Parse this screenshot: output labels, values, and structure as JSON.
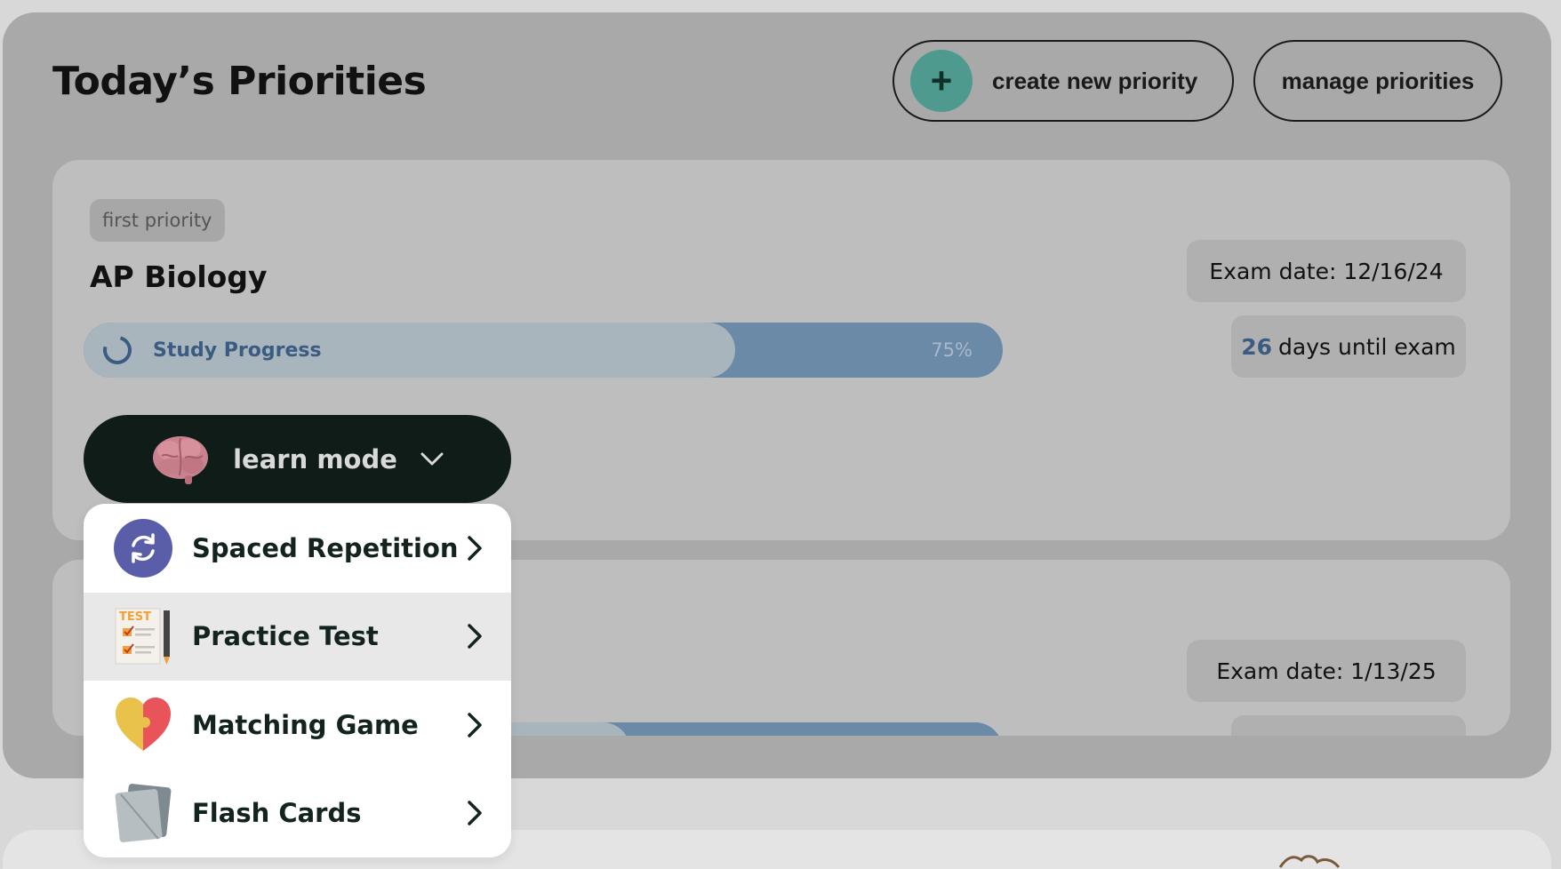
{
  "header": {
    "title": "Today’s Priorities",
    "create_label": "create new priority",
    "manage_label": "manage priorities"
  },
  "priorities": [
    {
      "tag": "first priority",
      "course": "AP Biology",
      "progress_label": "Study Progress",
      "progress_percent": 75,
      "progress_text": "75%",
      "exam_date": "Exam date: 12/16/24",
      "days_until": "26",
      "days_label": "days until exam"
    },
    {
      "exam_date": "Exam date: 1/13/25"
    }
  ],
  "learn_mode": {
    "label": "learn mode",
    "items": [
      {
        "label": "Spaced Repetition",
        "icon": "refresh-icon"
      },
      {
        "label": "Practice Test",
        "icon": "test-sheet-icon"
      },
      {
        "label": "Matching Game",
        "icon": "heart-puzzle-icon"
      },
      {
        "label": "Flash Cards",
        "icon": "flash-cards-icon"
      }
    ]
  },
  "colors": {
    "accent_green": "#4f9a8e",
    "progress_blue": "#6a8aa8",
    "learn_mode_bg": "#0f1c18",
    "spaced_rep_purple": "#5a5ea8"
  }
}
